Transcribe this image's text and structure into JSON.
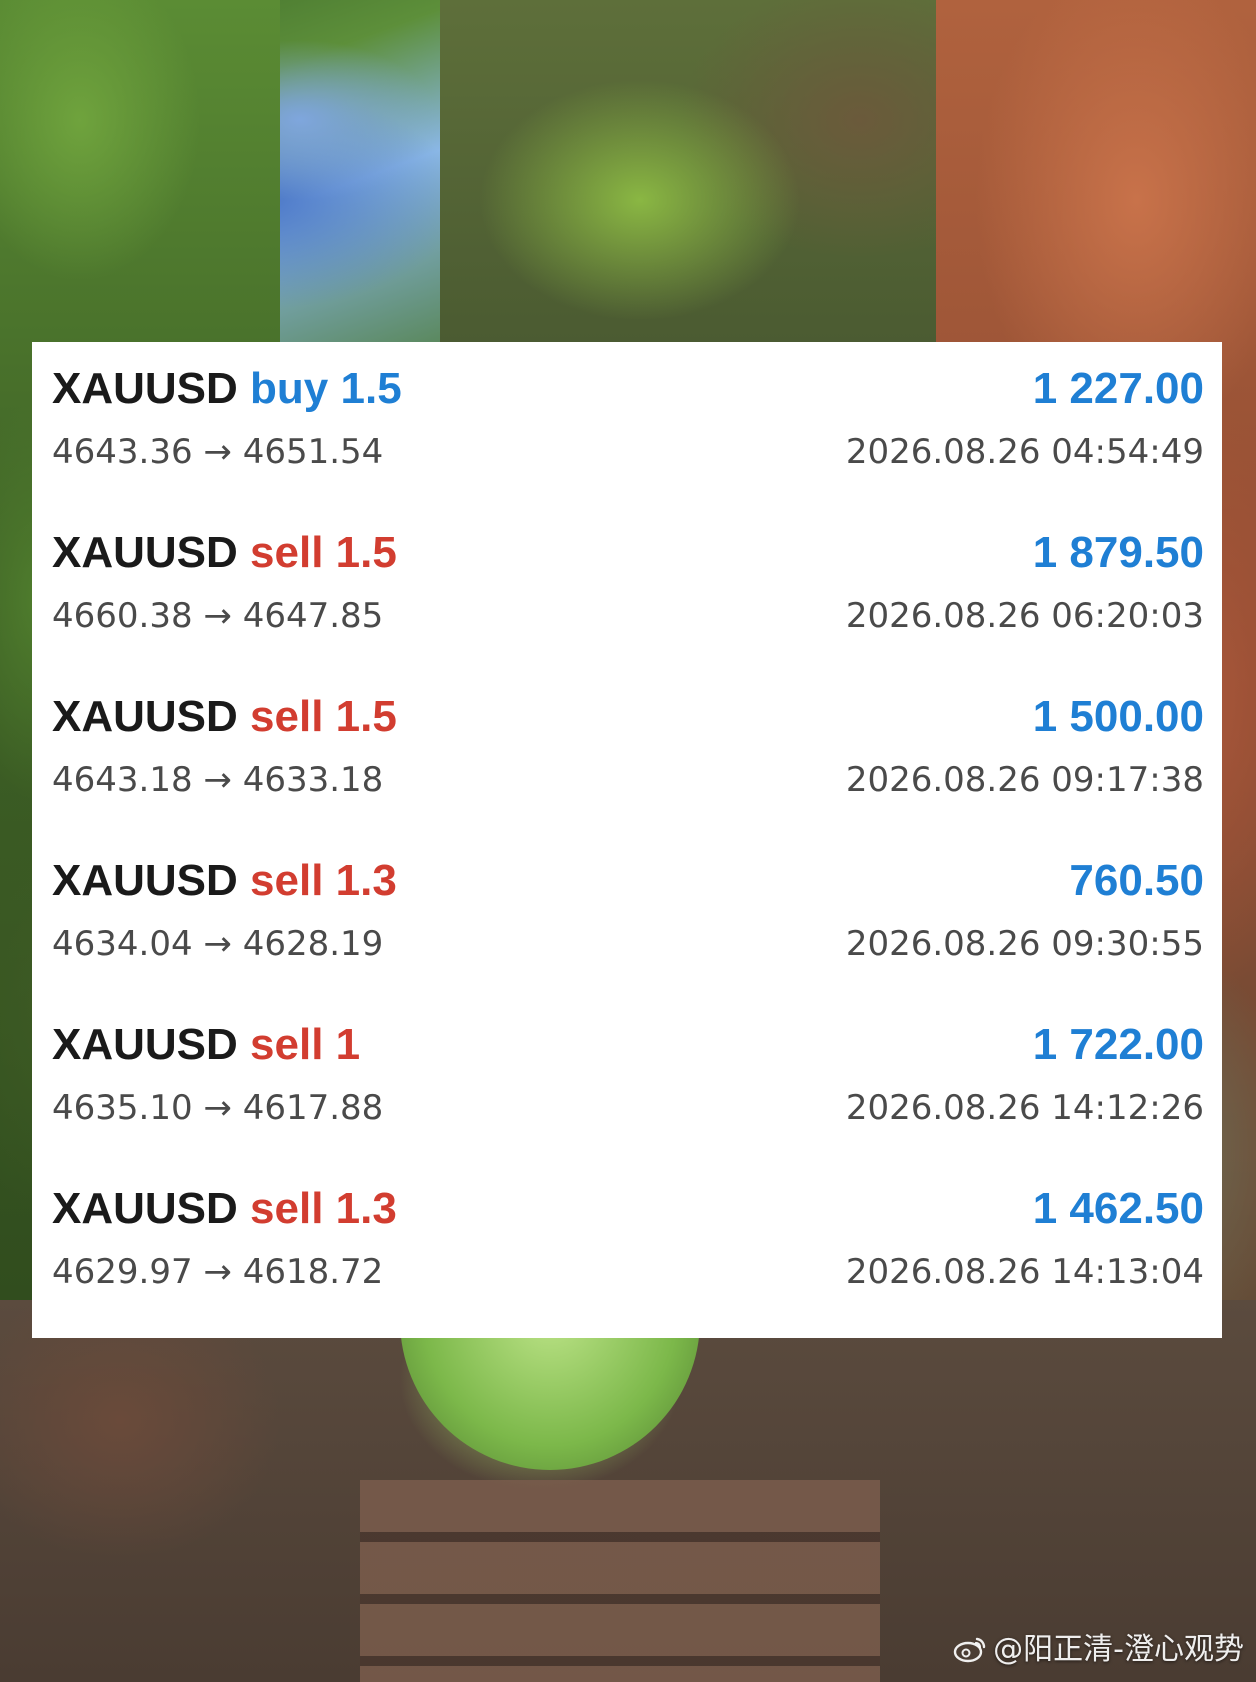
{
  "trades": [
    {
      "symbol": "XAUUSD",
      "side": "buy",
      "volume": "1.5",
      "prices": "4643.36 → 4651.54",
      "profit": "1 227.00",
      "time": "2026.08.26 04:54:49"
    },
    {
      "symbol": "XAUUSD",
      "side": "sell",
      "volume": "1.5",
      "prices": "4660.38 → 4647.85",
      "profit": "1 879.50",
      "time": "2026.08.26 06:20:03"
    },
    {
      "symbol": "XAUUSD",
      "side": "sell",
      "volume": "1.5",
      "prices": "4643.18 → 4633.18",
      "profit": "1 500.00",
      "time": "2026.08.26 09:17:38"
    },
    {
      "symbol": "XAUUSD",
      "side": "sell",
      "volume": "1.3",
      "prices": "4634.04 → 4628.19",
      "profit": "760.50",
      "time": "2026.08.26 09:30:55"
    },
    {
      "symbol": "XAUUSD",
      "side": "sell",
      "volume": "1",
      "prices": "4635.10 → 4617.88",
      "profit": "1 722.00",
      "time": "2026.08.26 14:12:26"
    },
    {
      "symbol": "XAUUSD",
      "side": "sell",
      "volume": "1.3",
      "prices": "4629.97 → 4618.72",
      "profit": "1 462.50",
      "time": "2026.08.26 14:13:04"
    }
  ],
  "colors": {
    "buy": "#1f7fd4",
    "sell": "#d23d30",
    "profit": "#1f7fd4",
    "symbol": "#1a1a1a",
    "secondary_text": "#4a4a4a"
  },
  "watermark": {
    "icon": "weibo-icon",
    "text": "@阳正清-澄心观势"
  }
}
